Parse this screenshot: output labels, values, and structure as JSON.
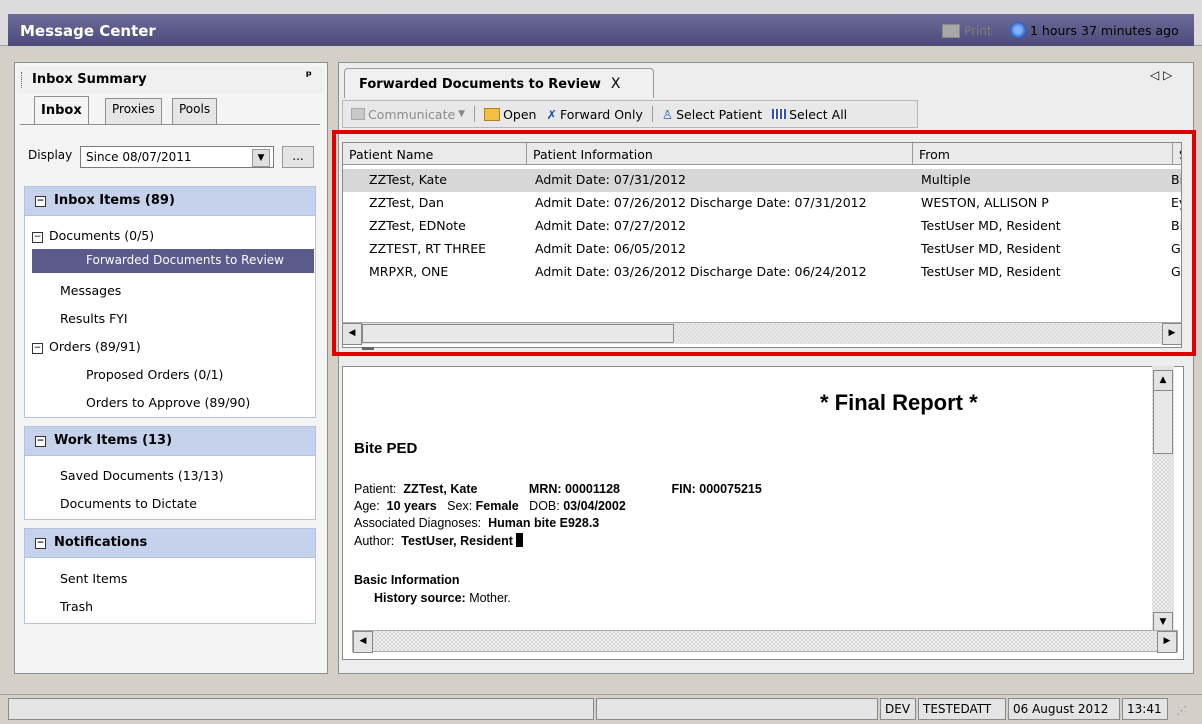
{
  "window": {
    "title": "Message Center",
    "print_label": "Print",
    "refresh_label": "1 hours 37 minutes ago"
  },
  "inbox_summary": {
    "title": "Inbox Summary",
    "tabs": [
      "Inbox",
      "Proxies",
      "Pools"
    ],
    "display_label": "Display",
    "display_value": "Since 08/07/2011",
    "dots_label": "...",
    "sections": {
      "inbox": {
        "title": "Inbox Items (89)",
        "items": {
          "documents": "Documents (0/5)",
          "forwarded": "Forwarded Documents to Review",
          "messages": "Messages",
          "results": "Results FYI",
          "orders": "Orders (89/91)",
          "proposed": "Proposed Orders (0/1)",
          "approve": "Orders to Approve (89/90)"
        }
      },
      "work": {
        "title": "Work Items (13)",
        "items": {
          "saved": "Saved Documents (13/13)",
          "dictate": "Documents to Dictate"
        }
      },
      "notifications": {
        "title": "Notifications",
        "items": {
          "sent": "Sent Items",
          "trash": "Trash"
        }
      }
    }
  },
  "doc_tab": {
    "label": "Forwarded Documents to Review",
    "close": "X",
    "nav": "◁ ▷"
  },
  "toolbar": {
    "communicate": "Communicate",
    "open": "Open",
    "forward_only": "Forward Only",
    "select_patient": "Select Patient",
    "select_all": "Select All"
  },
  "grid": {
    "columns": [
      "Patient Name",
      "Patient Information",
      "From",
      "Su"
    ],
    "rows": [
      {
        "name": "ZZTest, Kate",
        "info": "Admit Date: 07/31/2012",
        "from": "Multiple",
        "su": "Bit"
      },
      {
        "name": "ZZTest, Dan",
        "info": "Admit Date: 07/26/2012 Discharge Date: 07/31/2012",
        "from": "WESTON, ALLISON P",
        "su": "Ey"
      },
      {
        "name": "ZZTest, EDNote",
        "info": "Admit Date: 07/27/2012",
        "from": "TestUser MD, Resident",
        "su": "Bit"
      },
      {
        "name": "ZZTEST, RT THREE",
        "info": "Admit Date: 06/05/2012",
        "from": "TestUser MD, Resident",
        "su": "Ga"
      },
      {
        "name": "MRPXR, ONE",
        "info": "Admit Date: 03/26/2012 Discharge Date: 06/24/2012",
        "from": "TestUser MD, Resident",
        "su": "Ga"
      }
    ]
  },
  "report": {
    "heading": "* Final Report *",
    "title": "Bite PED",
    "patient_label": "Patient:",
    "patient": "ZZTest, Kate",
    "mrn_label": "MRN:",
    "mrn": "00001128",
    "fin_label": "FIN:",
    "fin": "000075215",
    "age_label": "Age:",
    "age": "10 years",
    "sex_label": "Sex:",
    "sex": "Female",
    "dob_label": "DOB:",
    "dob": "03/04/2002",
    "diag_label": "Associated Diagnoses:",
    "diag": "Human bite E928.3",
    "author_label": "Author:",
    "author": "TestUser, Resident",
    "basic_info": "Basic Information",
    "history_label": "History source:",
    "history": "Mother."
  },
  "status": {
    "env": "DEV",
    "user": "TESTEDATT",
    "date": "06 August 2012",
    "time": "13:41"
  }
}
